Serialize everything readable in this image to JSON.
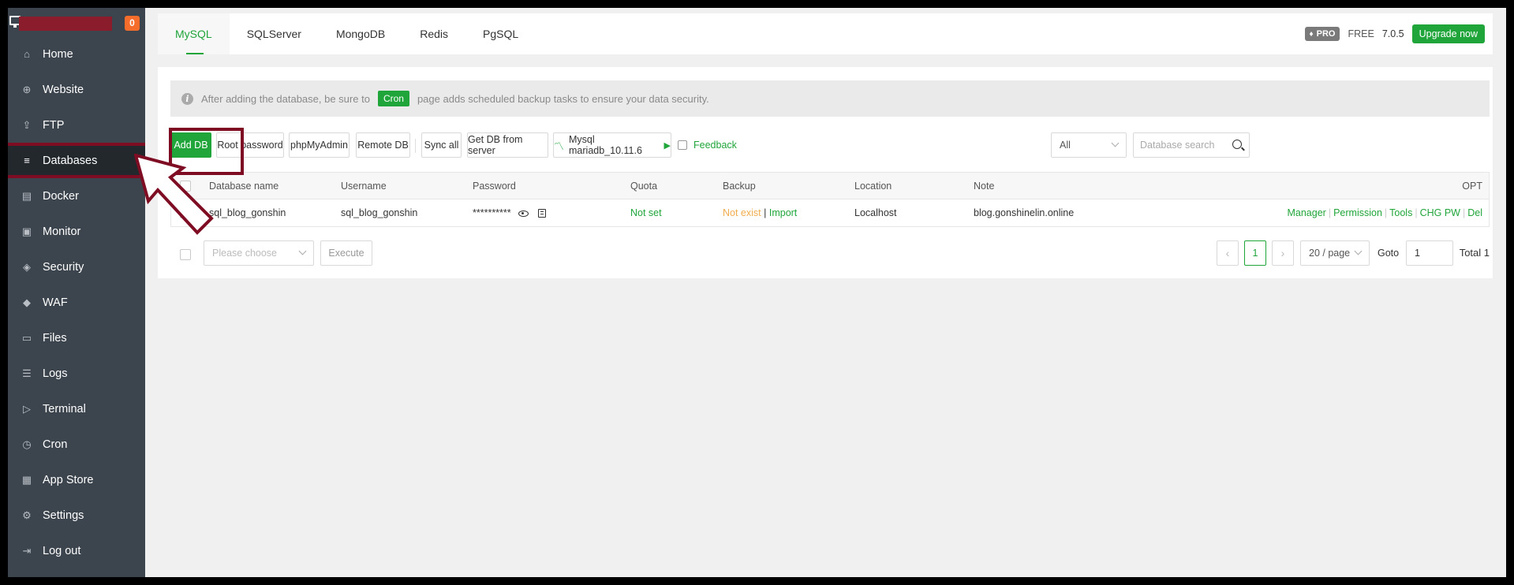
{
  "sidebar": {
    "badge": "0",
    "items": [
      {
        "label": "Home",
        "icon": "home-icon",
        "glyph": "⌂"
      },
      {
        "label": "Website",
        "icon": "globe-icon",
        "glyph": "⊕"
      },
      {
        "label": "FTP",
        "icon": "ftp-icon",
        "glyph": "⇪"
      },
      {
        "label": "Databases",
        "icon": "database-icon",
        "glyph": "≡"
      },
      {
        "label": "Docker",
        "icon": "docker-icon",
        "glyph": "▤"
      },
      {
        "label": "Monitor",
        "icon": "monitor-icon",
        "glyph": "▣"
      },
      {
        "label": "Security",
        "icon": "shield-icon",
        "glyph": "◈"
      },
      {
        "label": "WAF",
        "icon": "waf-icon",
        "glyph": "◆"
      },
      {
        "label": "Files",
        "icon": "folder-icon",
        "glyph": "▭"
      },
      {
        "label": "Logs",
        "icon": "logs-icon",
        "glyph": "☰"
      },
      {
        "label": "Terminal",
        "icon": "terminal-icon",
        "glyph": "▷"
      },
      {
        "label": "Cron",
        "icon": "calendar-icon",
        "glyph": "◷"
      },
      {
        "label": "App Store",
        "icon": "apps-icon",
        "glyph": "▦"
      },
      {
        "label": "Settings",
        "icon": "gear-icon",
        "glyph": "⚙"
      },
      {
        "label": "Log out",
        "icon": "logout-icon",
        "glyph": "⇥"
      }
    ]
  },
  "tabs": [
    "MySQL",
    "SQLServer",
    "MongoDB",
    "Redis",
    "PgSQL"
  ],
  "header": {
    "pro": "PRO",
    "free": "FREE",
    "version": "7.0.5",
    "upgrade": "Upgrade now"
  },
  "notice": {
    "before": "After adding the database, be sure to",
    "tag": "Cron",
    "after": "page adds scheduled backup tasks to ensure your data security."
  },
  "toolbar": {
    "add_db": "Add DB",
    "root_password": "Root password",
    "phpmyadmin": "phpMyAdmin",
    "remote_db": "Remote DB",
    "sync_all": "Sync all",
    "get_db": "Get DB from server",
    "mysql_version": "Mysql mariadb_10.11.6",
    "feedback": "Feedback",
    "filter": "All",
    "search_placeholder": "Database search"
  },
  "table": {
    "headers": [
      "Database name",
      "Username",
      "Password",
      "Quota",
      "Backup",
      "Location",
      "Note",
      "OPT"
    ],
    "rows": [
      {
        "name": "sql_blog_gonshin",
        "username": "sql_blog_gonshin",
        "password": "**********",
        "quota": "Not set",
        "backup_status": "Not exist",
        "backup_import": "Import",
        "location": "Localhost",
        "note": "blog.gonshinelin.online",
        "ops": [
          "Manager",
          "Permission",
          "Tools",
          "CHG PW",
          "Del"
        ]
      }
    ]
  },
  "bottom": {
    "batch_placeholder": "Please choose",
    "execute": "Execute",
    "page": "1",
    "per_page": "20 / page",
    "goto": "Goto",
    "goto_value": "1",
    "total": "Total 1"
  }
}
